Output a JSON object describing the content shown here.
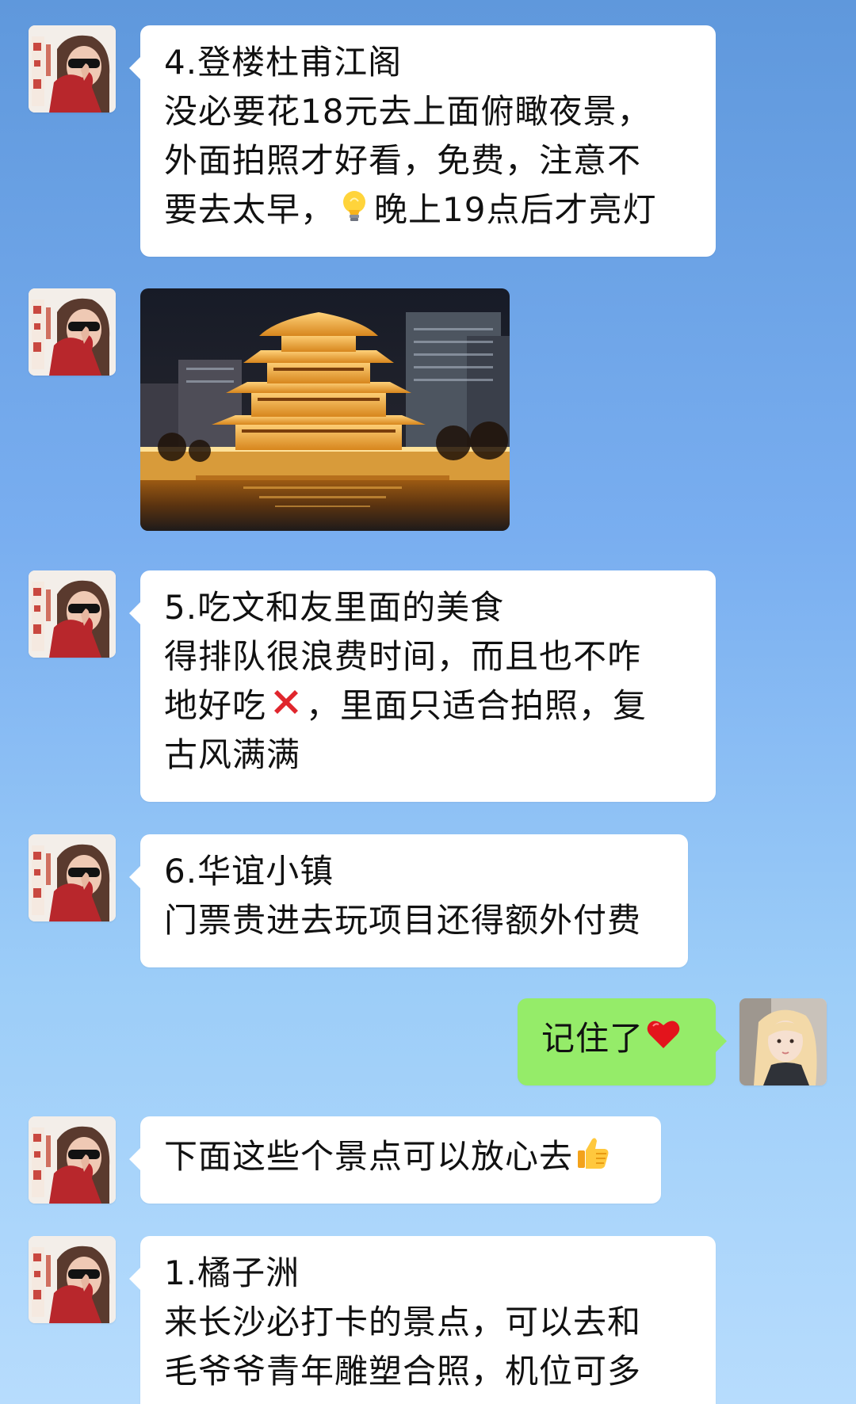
{
  "messages": {
    "m1": {
      "title": "4.登楼杜甫江阁",
      "line2": "没必要花18元去上面俯瞰夜景，",
      "line3": "外面拍照才好看，免费，注意不",
      "line4_pre": "要去太早，",
      "line4_post": "晚上19点后才亮灯",
      "emoji": "lightbulb-icon"
    },
    "m2": {
      "image": "photo of lit ancient pavilion"
    },
    "m3": {
      "title": "5.吃文和友里面的美食",
      "line2": "得排队很浪费时间，而且也不咋",
      "line3_pre": "地好吃",
      "line3_post": "，里面只适合拍照，复",
      "line4": "古风满满",
      "emoji": "cross-icon"
    },
    "m4": {
      "title": "6.华谊小镇",
      "line2": "门票贵进去玩项目还得额外付费"
    },
    "m5": {
      "text": "记住了",
      "emoji": "heart-icon"
    },
    "m6": {
      "text": "下面这些个景点可以放心去",
      "emoji": "thumbs-up-icon"
    },
    "m7": {
      "title": "1.橘子洲",
      "line2": "来长沙必打卡的景点，可以去和",
      "line3": "毛爷爷青年雕塑合照，机位可多"
    }
  },
  "colors": {
    "left_bubble": "#ffffff",
    "right_bubble": "#95ec69",
    "background_top": "#5f98dc",
    "background_bottom": "#b7dcfd"
  }
}
